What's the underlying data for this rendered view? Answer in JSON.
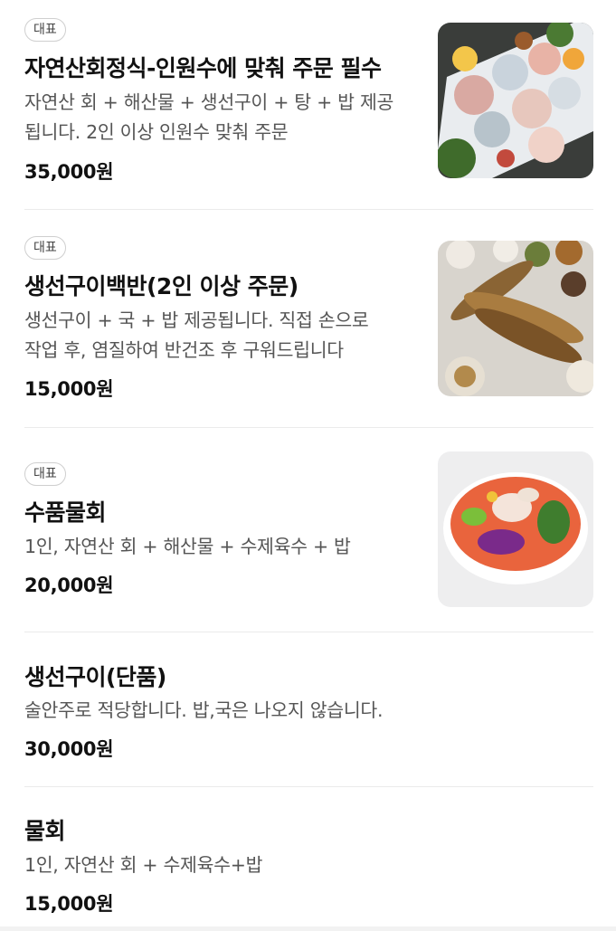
{
  "menu": {
    "items": [
      {
        "badge": "대표",
        "name": "자연산회정식-인원수에 맞춰 주문 필수",
        "desc_line1": "자연산 회 + 해산물 + 생선구이 + 탕 + 밥 제공",
        "desc_line2": "됩니다. 2인 이상 인원수 맞춰 주문",
        "price": "35,000원",
        "image": "sashimi-platter-photo"
      },
      {
        "badge": "대표",
        "name": "생선구이백반(2인 이상 주문)",
        "desc_line1": "생선구이 + 국 + 밥 제공됩니다. 직접 손으로",
        "desc_line2": "작업 후, 염질하여 반건조 후 구워드립니다",
        "price": "15,000원",
        "image": "grilled-fish-photo"
      },
      {
        "badge": "대표",
        "name": "수품물회",
        "desc_line1": "1인, 자연산 회 + 해산물 + 수제육수 + 밥",
        "price": "20,000원",
        "image": "mulhoe-bowl-photo"
      },
      {
        "name": "생선구이(단품)",
        "desc_line1": "술안주로 적당합니다. 밥,국은 나오지 않습니다.",
        "price": "30,000원"
      },
      {
        "name": "물회",
        "desc_line1": "1인, 자연산 회 + 수제육수+밥",
        "price": "15,000원"
      }
    ]
  }
}
